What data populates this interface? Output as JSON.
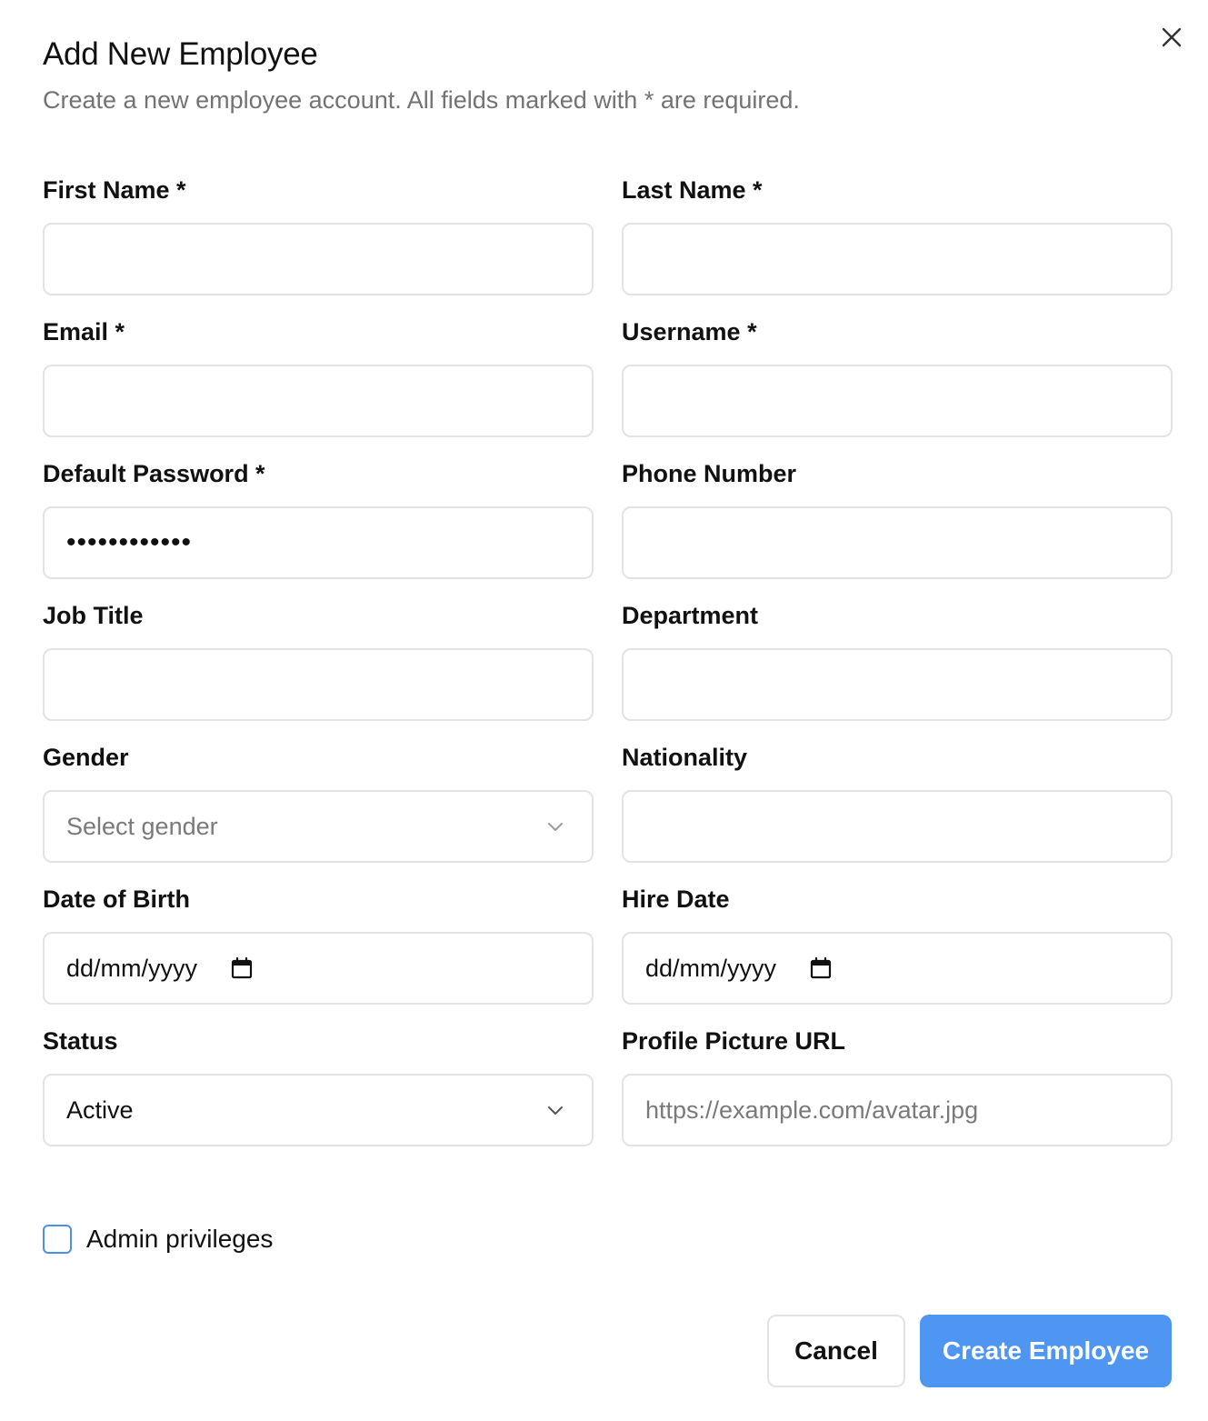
{
  "dialog": {
    "title": "Add New Employee",
    "subtitle": "Create a new employee account. All fields marked with * are required.",
    "close_icon": "close-icon"
  },
  "fields": {
    "first_name": {
      "label": "First Name *",
      "value": ""
    },
    "last_name": {
      "label": "Last Name *",
      "value": ""
    },
    "email": {
      "label": "Email *",
      "value": ""
    },
    "username": {
      "label": "Username *",
      "value": ""
    },
    "default_password": {
      "label": "Default Password *",
      "value": "••••••••••••"
    },
    "phone_number": {
      "label": "Phone Number",
      "value": ""
    },
    "job_title": {
      "label": "Job Title",
      "value": ""
    },
    "department": {
      "label": "Department",
      "value": ""
    },
    "gender": {
      "label": "Gender",
      "placeholder": "Select gender"
    },
    "nationality": {
      "label": "Nationality",
      "value": ""
    },
    "date_of_birth": {
      "label": "Date of Birth",
      "placeholder": "dd/mm/yyyy"
    },
    "hire_date": {
      "label": "Hire Date",
      "placeholder": "dd/mm/yyyy"
    },
    "status": {
      "label": "Status",
      "value": "Active"
    },
    "profile_picture_url": {
      "label": "Profile Picture URL",
      "placeholder": "https://example.com/avatar.jpg"
    }
  },
  "admin_checkbox": {
    "label": "Admin privileges",
    "checked": false
  },
  "actions": {
    "cancel_label": "Cancel",
    "create_label": "Create Employee"
  },
  "colors": {
    "primary": "#4f96f2",
    "border": "#e3e3e3",
    "muted_text": "#737373",
    "checkbox_border": "#4a8fe8"
  }
}
